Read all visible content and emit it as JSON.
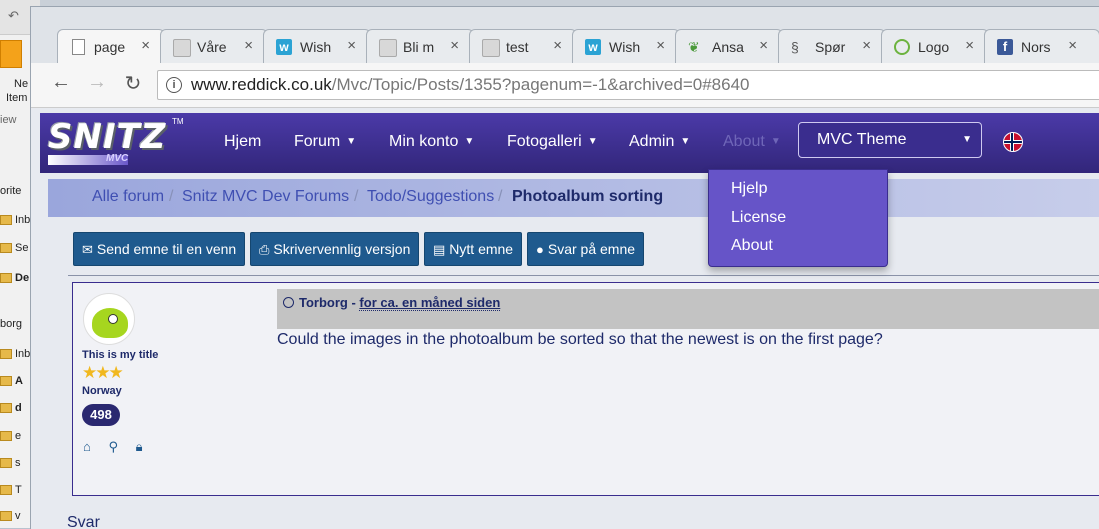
{
  "outlook_bg": {
    "items": [
      "Ne",
      "Item",
      "iew",
      "orite",
      "Inb",
      "Se",
      "De",
      "borg",
      "Inb",
      "A",
      "d",
      "e",
      "s",
      "T",
      "v"
    ]
  },
  "tabs": [
    {
      "label": "page",
      "icon": "document-icon"
    },
    {
      "label": "Våre",
      "icon": "ghost-icon"
    },
    {
      "label": "Wish",
      "icon": "wish-icon"
    },
    {
      "label": "Bli m",
      "icon": "ghost-icon"
    },
    {
      "label": "test",
      "icon": "ghost-icon"
    },
    {
      "label": "Wish",
      "icon": "wish-icon"
    },
    {
      "label": "Ansa",
      "icon": "leaf-icon"
    },
    {
      "label": "Spør",
      "icon": "question-icon"
    },
    {
      "label": "Logo",
      "icon": "green-circle-icon"
    },
    {
      "label": "Nors",
      "icon": "facebook-icon"
    }
  ],
  "toolbar": {
    "url_host": "www.reddick.co.uk",
    "url_path": "/Mvc/Topic/Posts/1355?pagenum=-1&archived=0#8640"
  },
  "nav": {
    "logo_text": "SNITZ",
    "logo_tm": "TM",
    "logo_sub": "MVC",
    "items": [
      "Hjem",
      "Forum",
      "Min konto",
      "Fotogalleri",
      "Admin",
      "About"
    ],
    "theme_value": "MVC Theme"
  },
  "about_menu": [
    "Hjelp",
    "License",
    "About"
  ],
  "breadcrumb": {
    "items": [
      "Alle forum",
      "Snitz MVC Dev Forums",
      "Todo/Suggestions"
    ],
    "current": "Photoalbum sorting"
  },
  "actions": [
    "Send emne til en venn",
    "Skrivervennlig versjon",
    "Nytt emne",
    "Svar på emne"
  ],
  "post": {
    "user_title": "This is my title",
    "stars": "★★★",
    "country": "Norway",
    "post_count": "498",
    "author": "Torborg",
    "time": "for ca. en måned siden",
    "body": "Could the images in the photoalbum be sorted so that the newest is on the first page?"
  },
  "reply_label": "Svar",
  "colors": {
    "navbar": "#3a2d8e",
    "dropdown": "#6654c8",
    "button": "#1f5a8e",
    "text": "#1e2a6a"
  }
}
